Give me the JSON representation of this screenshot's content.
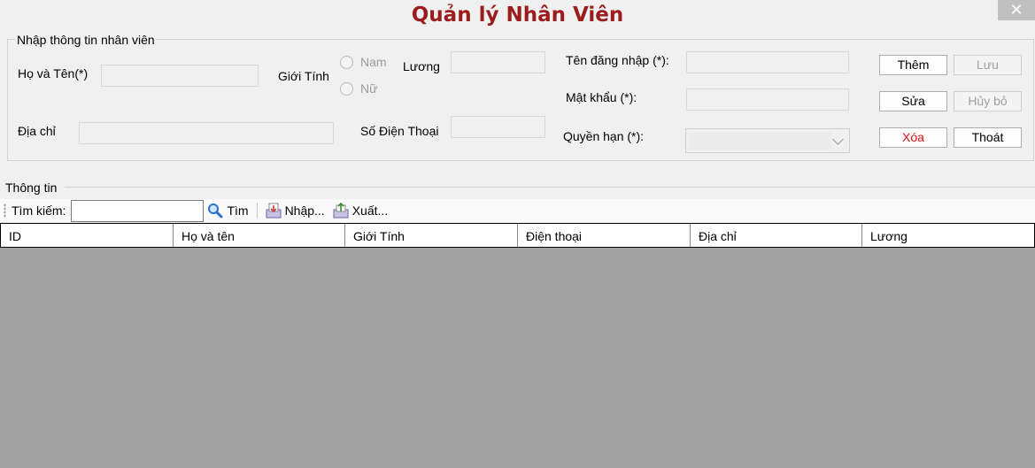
{
  "window": {
    "title": "Quản lý Nhân Viên",
    "close_glyph": "✕"
  },
  "form": {
    "legend": "Nhập thông tin nhân viên",
    "fullname_label": "Họ và Tên(*)",
    "gender_label": "Giới Tính",
    "gender_options": [
      "Nam",
      "Nữ"
    ],
    "salary_label": "Lương",
    "address_label": "Địa chỉ",
    "phone_label": "Số Điện Thoại",
    "username_label": "Tên đăng nhập (*):",
    "password_label": "Mật khẩu (*):",
    "role_label": "Quyền hạn (*):",
    "role_value": ""
  },
  "buttons": {
    "add": "Thêm",
    "save": "Lưu",
    "edit": "Sửa",
    "cancel": "Hủy bỏ",
    "delete": "Xóa",
    "exit": "Thoát"
  },
  "info": {
    "section_label": "Thông tin",
    "search_label": "Tìm kiếm:",
    "search_value": "",
    "find_button": "Tìm",
    "import_button": "Nhập...",
    "export_button": "Xuất..."
  },
  "table": {
    "columns": [
      "ID",
      "Họ và tên",
      "Giới Tính",
      "Điện thoại",
      "Địa chỉ",
      "Lương"
    ]
  },
  "icons": [
    "close-icon",
    "search-icon",
    "import-icon",
    "export-icon",
    "chevron-down-icon"
  ],
  "colors": {
    "title": "#9b1c1c",
    "delete_text": "#e01010",
    "grid_background": "#a0a0a0"
  }
}
